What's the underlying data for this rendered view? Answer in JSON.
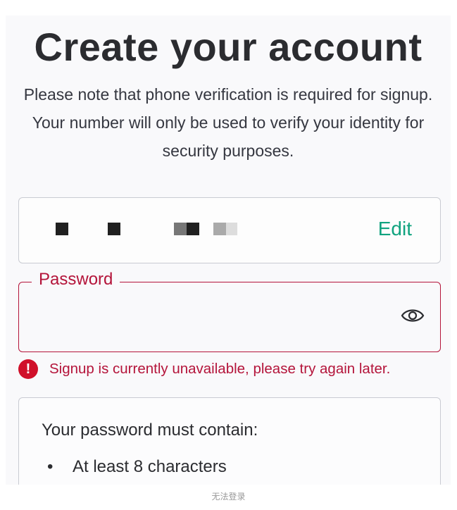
{
  "title": "Create your account",
  "subtitle": "Please note that phone verification is required for signup. Your number will only be used to verify your identity for security purposes.",
  "email_field": {
    "value_masked": true,
    "edit_label": "Edit"
  },
  "password_field": {
    "label": "Password",
    "value": "",
    "toggle_icon": "eye-icon",
    "border_color": "#b4143a"
  },
  "error": {
    "icon": "alert-icon",
    "icon_glyph": "!",
    "message": "Signup is currently unavailable, please try again later.",
    "color": "#b4143a"
  },
  "requirements": {
    "title": "Your password must contain:",
    "bullet": "•",
    "items": [
      "At least 8 characters"
    ]
  },
  "accent_color": "#10a37f",
  "caption": "无法登录"
}
